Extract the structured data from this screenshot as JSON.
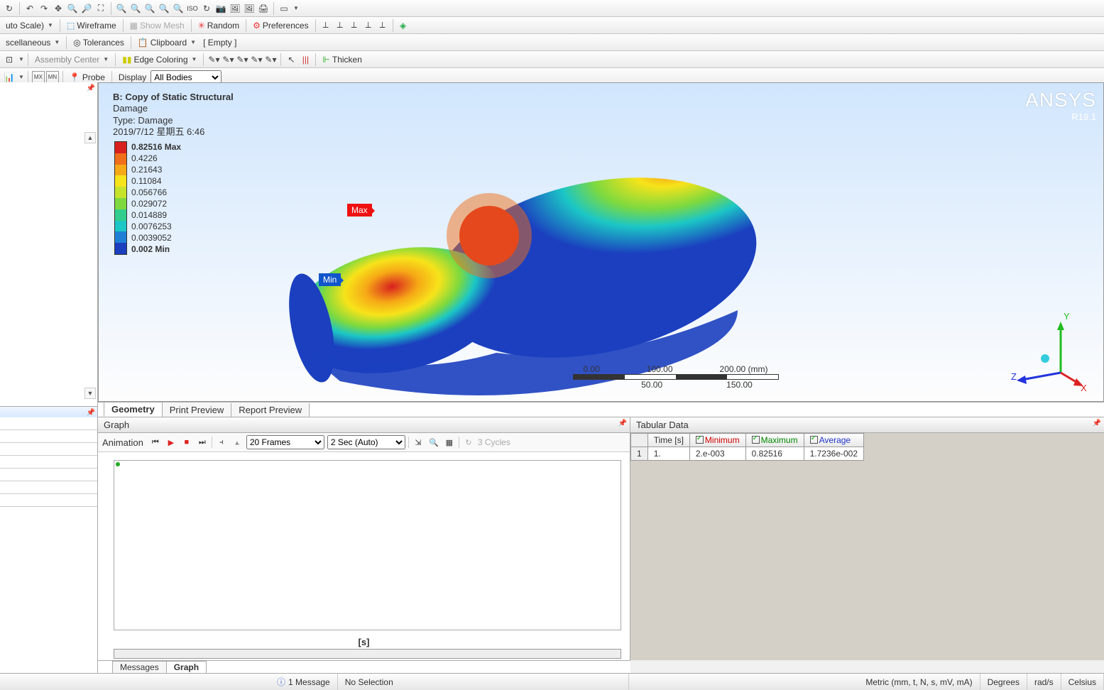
{
  "toolbar1": {
    "autoscale": "uto Scale)",
    "wireframe": "Wireframe",
    "showmesh": "Show Mesh",
    "random": "Random",
    "preferences": "Preferences"
  },
  "toolbar2": {
    "misc": "scellaneous",
    "tolerances": "Tolerances",
    "clipboard": "Clipboard",
    "empty": "[ Empty ]"
  },
  "toolbar3": {
    "assembly": "Assembly Center",
    "edgecoloring": "Edge Coloring",
    "thicken": "Thicken"
  },
  "toolbar4": {
    "probe": "Probe",
    "display": "Display",
    "allbodies": "All Bodies"
  },
  "result": {
    "title": "B: Copy of Static Structural",
    "sub1": "Damage",
    "sub2": "Type: Damage",
    "sub3": "2019/7/12 星期五 6:46"
  },
  "legend": {
    "values": [
      "0.82516 Max",
      "0.4226",
      "0.21643",
      "0.11084",
      "0.056766",
      "0.029072",
      "0.014889",
      "0.0076253",
      "0.0039052",
      "0.002 Min"
    ],
    "colors": [
      "#d8201f",
      "#ef6f1a",
      "#f6a916",
      "#f7e31a",
      "#c6e32c",
      "#7dd93f",
      "#32ce8d",
      "#1bc6c6",
      "#1f7fd6",
      "#1b3fbf"
    ]
  },
  "markers": {
    "max": "Max",
    "min": "Min"
  },
  "brand": {
    "name": "ANSYS",
    "ver": "R19.1"
  },
  "ruler": {
    "top": [
      "0.00",
      "100.00",
      "200.00 (mm)"
    ],
    "bot": [
      "50.00",
      "150.00"
    ]
  },
  "tabs": {
    "geometry": "Geometry",
    "print": "Print Preview",
    "report": "Report Preview"
  },
  "graph": {
    "title": "Graph",
    "anim": "Animation",
    "frames": "20 Frames",
    "speed": "2 Sec (Auto)",
    "cycles": "3 Cycles",
    "xlabel": "[s]"
  },
  "tabular": {
    "title": "Tabular Data",
    "headers": {
      "time": "Time [s]",
      "min": "Minimum",
      "max": "Maximum",
      "avg": "Average"
    },
    "row": {
      "n": "1",
      "time": "1.",
      "min": "2.e-003",
      "max": "0.82516",
      "avg": "1.7236e-002"
    }
  },
  "btabs": {
    "messages": "Messages",
    "graph": "Graph"
  },
  "status": {
    "msg": "1 Message",
    "sel": "No Selection",
    "units": "Metric (mm, t, N, s, mV, mA)",
    "ang": "Degrees",
    "rot": "rad/s",
    "temp": "Celsius"
  },
  "triad": {
    "x": "X",
    "y": "Y",
    "z": "Z"
  },
  "chart_data": {
    "type": "line",
    "title": "Damage vs time",
    "xlabel": "[s]",
    "ylabel": "",
    "x": [
      1
    ],
    "series": [
      {
        "name": "Minimum",
        "values": [
          0.002
        ]
      },
      {
        "name": "Maximum",
        "values": [
          0.82516
        ]
      },
      {
        "name": "Average",
        "values": [
          0.017236
        ]
      }
    ],
    "xlim": [
      0,
      1
    ],
    "ylim": [
      0,
      1
    ]
  }
}
